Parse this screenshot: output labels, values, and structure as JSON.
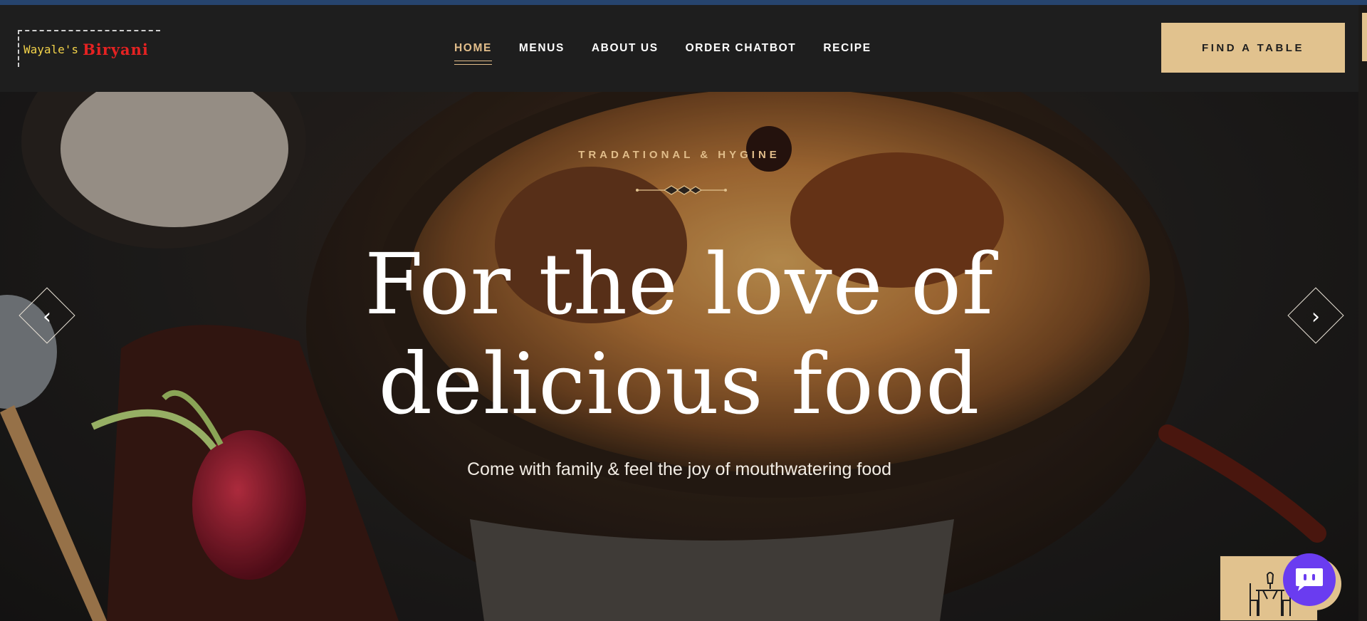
{
  "brand": {
    "part1": "Wayale's",
    "part2": "Biryani"
  },
  "nav": {
    "items": [
      {
        "label": "HOME",
        "active": true
      },
      {
        "label": "MENUS",
        "active": false
      },
      {
        "label": "ABOUT US",
        "active": false
      },
      {
        "label": "ORDER CHATBOT",
        "active": false
      },
      {
        "label": "RECIPE",
        "active": false
      }
    ]
  },
  "header": {
    "cta_label": "FIND A TABLE"
  },
  "hero": {
    "subtitle": "TRADATIONAL & HYGINE",
    "title_line1": "For the love of",
    "title_line2": "delicious food",
    "tagline": "Come with family & feel the joy of mouthwatering food"
  },
  "icons": {
    "prev": "chevron-left-icon",
    "next": "chevron-right-icon",
    "table": "dining-table-icon",
    "chat": "chat-bubble-icon"
  },
  "colors": {
    "accent": "#e1c28e",
    "header_bg": "#1e1e1e",
    "chat": "#6a3cf0",
    "top_strip": "#26446e",
    "logo_yellow": "#f3d34a",
    "logo_red": "#e52222"
  }
}
